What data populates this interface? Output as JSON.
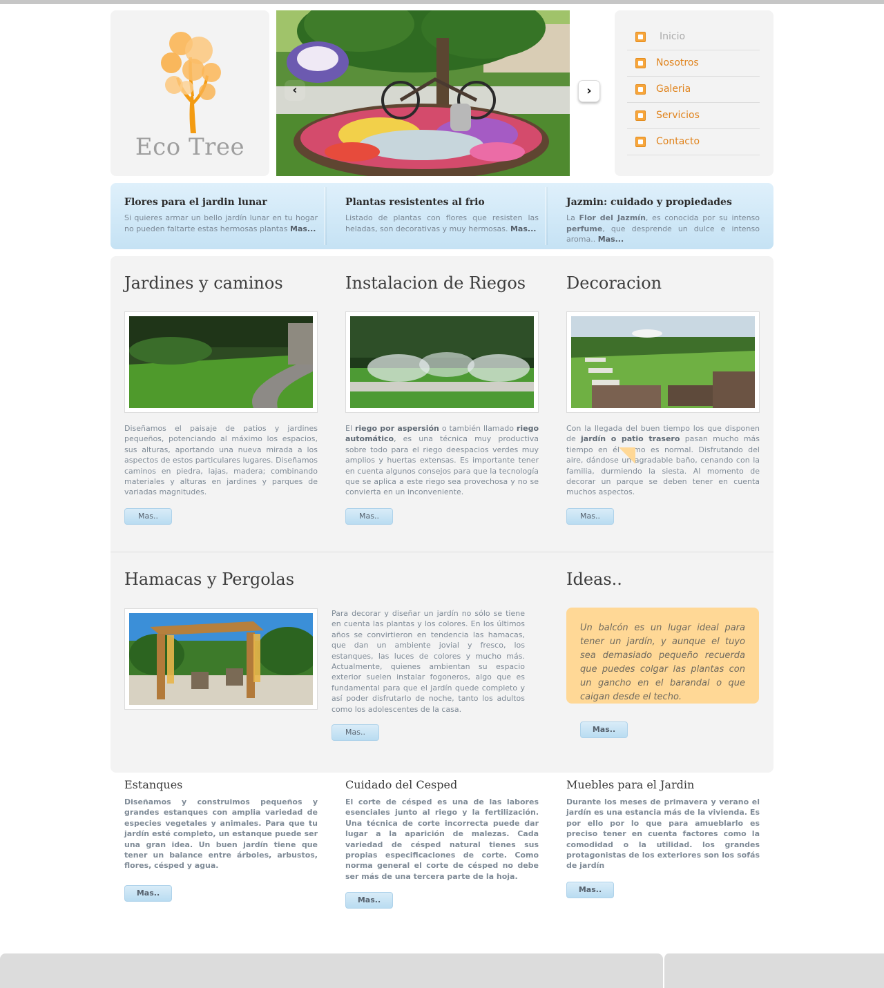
{
  "brand": {
    "name": "Eco Tree"
  },
  "slider": {
    "prev_icon": "chevron-left-icon",
    "next_icon": "chevron-right-icon"
  },
  "nav": {
    "items": [
      {
        "label": "Inicio",
        "icon": "home-icon",
        "active": true
      },
      {
        "label": "Nosotros",
        "icon": "about-icon",
        "active": false
      },
      {
        "label": "Galeria",
        "icon": "gallery-icon",
        "active": false
      },
      {
        "label": "Servicios",
        "icon": "services-icon",
        "active": false
      },
      {
        "label": "Contacto",
        "icon": "mail-icon",
        "active": false
      }
    ]
  },
  "features": [
    {
      "title": "Flores para el jardin lunar",
      "text": "Si quieres armar un bello jardín lunar en tu hogar no pueden faltarte estas hermosas plantas",
      "more": "Mas..."
    },
    {
      "title": "Plantas resistentes al frio",
      "text": "Listado de plantas con flores que resisten las heladas, son decorativas y muy hermosas.",
      "more": "Mas..."
    },
    {
      "title": "Jazmin: cuidado y propiedades",
      "text_a": "La",
      "bold_a": "Flor del Jazmín",
      "text_b": ", es conocida por su intenso",
      "bold_b": "perfume",
      "text_c": ", que desprende un dulce e intenso aroma..",
      "more": "Mas..."
    }
  ],
  "sections": {
    "jardines": {
      "title": "Jardines y caminos",
      "text": "Diseñamos el paisaje de patios y jardines pequeños, potenciando al máximo los espacios, sus alturas, aportando una nueva mirada a los aspectos de estos particulares lugares. Diseñamos caminos en piedra, lajas, madera; combinando materiales y alturas en jardines y parques de variadas magnitudes.",
      "button": "Mas.."
    },
    "riegos": {
      "title": "Instalacion de Riegos",
      "t1": "El",
      "b1": "riego por aspersión",
      "t2": "o también llamado",
      "b2": "riego automático",
      "t3": ", es una técnica muy productiva sobre todo para el riego deespacios verdes muy amplios y huertas extensas. Es importante tener en cuenta algunos consejos para que la tecnología que se aplica a este riego sea provechosa y no se convierta en un inconveniente.",
      "button": "Mas.."
    },
    "decoracion": {
      "title": "Decoracion",
      "t1": "Con la llegada del buen tiempo los que disponen de",
      "b1": "jardín o patio trasero",
      "t2": "pasan mucho más tiempo en él como es normal. Disfrutando del aire, dándose un agradable baño, cenando con la familia, durmiendo la siesta. Al momento de decorar un parque se deben tener en cuenta muchos aspectos.",
      "button": "Mas.."
    },
    "hamacas": {
      "title": "Hamacas y Pergolas",
      "text": "Para decorar y diseñar un jardín no sólo se tiene en cuenta las plantas y los colores. En los últimos años se convirtieron en tendencia las hamacas, que dan un ambiente jovial y fresco, los estanques, las luces de colores y mucho más. Actualmente, quienes ambientan su espacio exterior suelen instalar fogoneros, algo que es fundamental para que el jardín quede completo y así poder disfrutarlo de noche, tanto los adultos como los adolescentes de la casa.",
      "button": "Mas.."
    },
    "ideas": {
      "title": "Ideas..",
      "quote": "Un balcón es un lugar ideal para tener un jardín, y aunque el tuyo sea demasiado pequeño recuerda que puedes colgar las plantas con un gancho en el barandal o que caigan desde el techo.",
      "button": "Mas.."
    }
  },
  "bottom": [
    {
      "title": "Estanques",
      "text": "Diseñamos y construimos pequeños y grandes estanques con amplia variedad de especies vegetales y animales. Para que tu jardín esté completo, un estanque puede ser una gran idea. Un buen jardín tiene que tener un balance entre árboles, arbustos, flores, césped y agua.",
      "button": "Mas.."
    },
    {
      "title": "Cuidado del Cesped",
      "text": "El corte de césped es una de las labores esenciales junto al riego y la fertilización. Una técnica de corte incorrecta puede dar lugar a la aparición de malezas. Cada variedad de césped natural tienes sus propias especificaciones de corte. Como norma general el corte de césped no debe ser más de una tercera parte de la hoja.",
      "button": "Mas.."
    },
    {
      "title": "Muebles para el Jardin",
      "text": "Durante los meses de primavera y verano el jardín es una estancia más de la vivienda. Es por ello por lo que para amueblarlo es preciso tener en cuenta factores como la comodidad o la utilidad. los grandes protagonistas de los exteriores son los sofás de jardín",
      "button": "Mas.."
    }
  ],
  "colors": {
    "accent": "#e0831c",
    "panel": "#f3f3f3",
    "feature_bar": "#c5e2f4",
    "idea_bubble": "#ffd896",
    "footer": "#dcdcdc"
  }
}
